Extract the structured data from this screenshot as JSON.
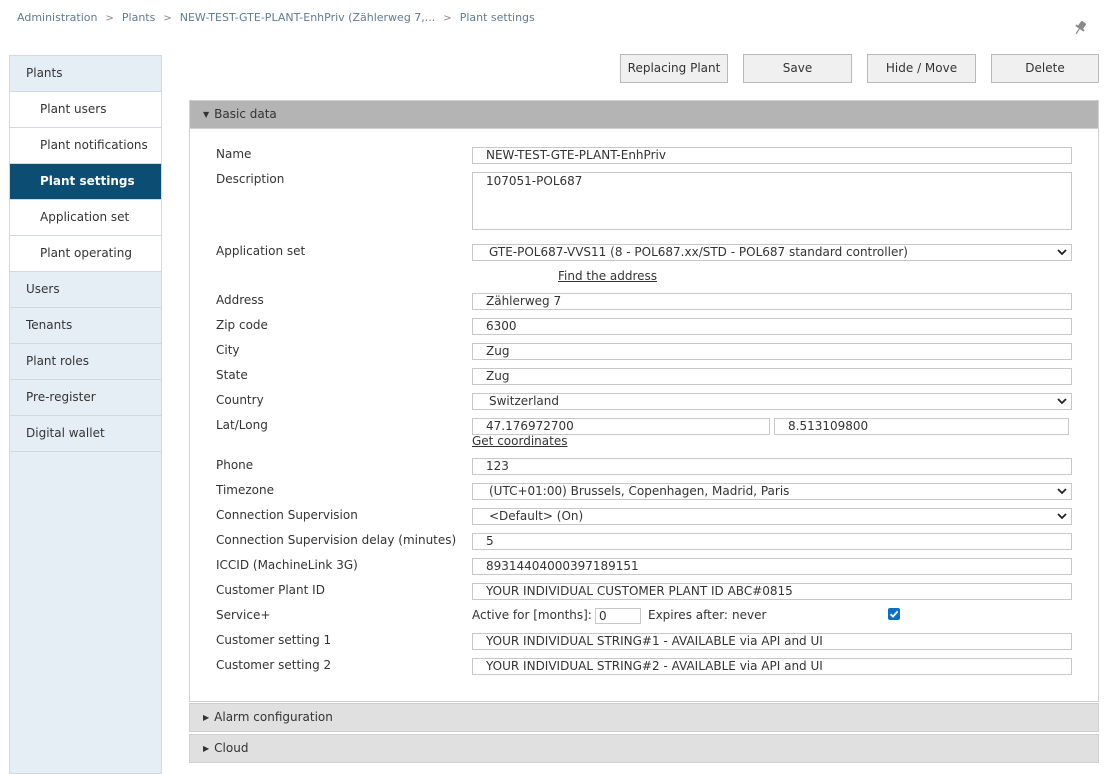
{
  "breadcrumb": {
    "items": [
      "Administration",
      "Plants",
      "NEW-TEST-GTE-PLANT-EnhPriv (Zählerweg 7,..."
    ],
    "current": "Plant settings"
  },
  "sidebar": {
    "items": [
      {
        "label": "Plants"
      },
      {
        "label": "Plant users"
      },
      {
        "label": "Plant notifications"
      },
      {
        "label": "Plant settings"
      },
      {
        "label": "Application set"
      },
      {
        "label": "Plant operating"
      },
      {
        "label": "Users"
      },
      {
        "label": "Tenants"
      },
      {
        "label": "Plant roles"
      },
      {
        "label": "Pre-register"
      },
      {
        "label": "Digital wallet"
      }
    ]
  },
  "toolbar": {
    "replacing_plant": "Replacing Plant",
    "save": "Save",
    "hide_move": "Hide / Move",
    "delete": "Delete"
  },
  "panels": {
    "basic_data": "Basic data",
    "alarm_configuration": "Alarm configuration",
    "cloud": "Cloud"
  },
  "form": {
    "name": {
      "label": "Name",
      "value": "NEW-TEST-GTE-PLANT-EnhPriv"
    },
    "description": {
      "label": "Description",
      "value": "107051-POL687"
    },
    "application_set": {
      "label": "Application set",
      "value": "GTE-POL687-VVS11 (8 - POL687.xx/STD - POL687 standard controller)"
    },
    "find_address": "Find the address",
    "address": {
      "label": "Address",
      "value": "Zählerweg 7"
    },
    "zip": {
      "label": "Zip code",
      "value": "6300"
    },
    "city": {
      "label": "City",
      "value": "Zug"
    },
    "state": {
      "label": "State",
      "value": "Zug"
    },
    "country": {
      "label": "Country",
      "value": "Switzerland"
    },
    "latlong": {
      "label": "Lat/Long",
      "lat": "47.176972700",
      "long": "8.513109800"
    },
    "get_coordinates": "Get coordinates",
    "phone": {
      "label": "Phone",
      "value": "123"
    },
    "timezone": {
      "label": "Timezone",
      "value": "(UTC+01:00) Brussels, Copenhagen, Madrid, Paris"
    },
    "connection_supervision": {
      "label": "Connection Supervision",
      "value": "<Default> (On)"
    },
    "connection_delay": {
      "label": "Connection Supervision delay (minutes)",
      "value": "5"
    },
    "iccid": {
      "label": "ICCID (MachineLink 3G)",
      "value": "89314404000397189151"
    },
    "customer_plant_id": {
      "label": "Customer Plant ID",
      "value": "YOUR INDIVIDUAL CUSTOMER PLANT ID ABC#0815"
    },
    "service_plus": {
      "label": "Service+",
      "active_for_label": "Active for [months]:",
      "active_for_value": "0",
      "expires_label": "Expires after:",
      "expires_value": "never",
      "checked": true
    },
    "customer_setting_1": {
      "label": "Customer setting 1",
      "value": "YOUR INDIVIDUAL STRING#1 - AVAILABLE via API and UI"
    },
    "customer_setting_2": {
      "label": "Customer setting 2",
      "value": "YOUR INDIVIDUAL STRING#2 - AVAILABLE via API and UI"
    }
  },
  "colors": {
    "sidebar_bg": "#e6eef5",
    "active_nav": "#0b4d73",
    "open_panel_header": "#b4b4b4",
    "collapsed_panel_header": "#e0e0e0",
    "checkbox": "#0b6fc6"
  }
}
